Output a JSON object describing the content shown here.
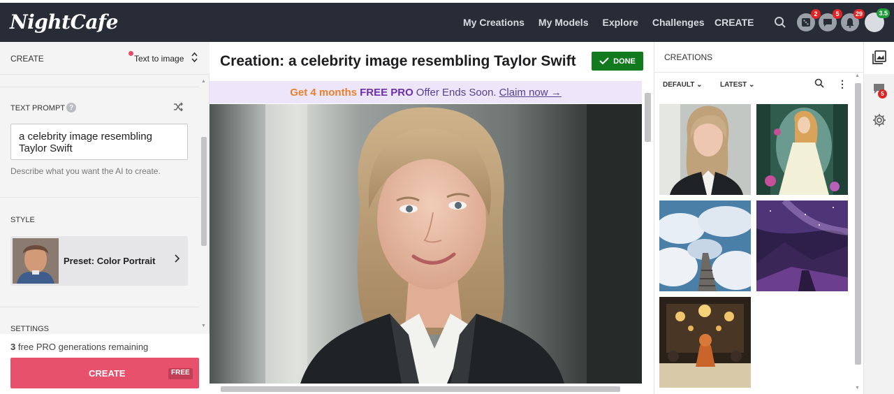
{
  "navbar": {
    "logo": "NightCafe",
    "links": [
      "My Creations",
      "My Models",
      "Explore",
      "Challenges"
    ],
    "create": "CREATE",
    "badges": {
      "dice": "2",
      "chat": "5",
      "bell": "29",
      "level": "3.5"
    }
  },
  "left": {
    "header_title": "CREATE",
    "mode": "Text to image",
    "prompt_label": "TEXT PROMPT",
    "prompt_value": "a celebrity image resembling Taylor Swift",
    "prompt_hint": "Describe what you want the AI to create.",
    "style_label": "STYLE",
    "preset_label": "Preset: Color Portrait",
    "settings_label": "SETTINGS",
    "free_count": "3",
    "free_text": " free PRO generations remaining",
    "create_label": "CREATE",
    "free_tag": "FREE"
  },
  "center": {
    "title": "Creation: a celebrity image resembling Taylor Swift",
    "done_label": "DONE",
    "promo": {
      "part1": "Get 4 months",
      "part2": "FREE PRO",
      "part3": "Offer Ends Soon.",
      "link": "Claim now →"
    }
  },
  "right": {
    "title": "CREATIONS",
    "filter_default": "DEFAULT",
    "filter_latest": "LATEST",
    "rail_badge": "5"
  },
  "colors": {
    "navbar": "#272c36",
    "create_button": "#e8516c",
    "done_button": "#117a1f",
    "promo_bg": "#ede6fb",
    "promo_orange": "#e8812c",
    "promo_purple": "#6b2fa8"
  }
}
